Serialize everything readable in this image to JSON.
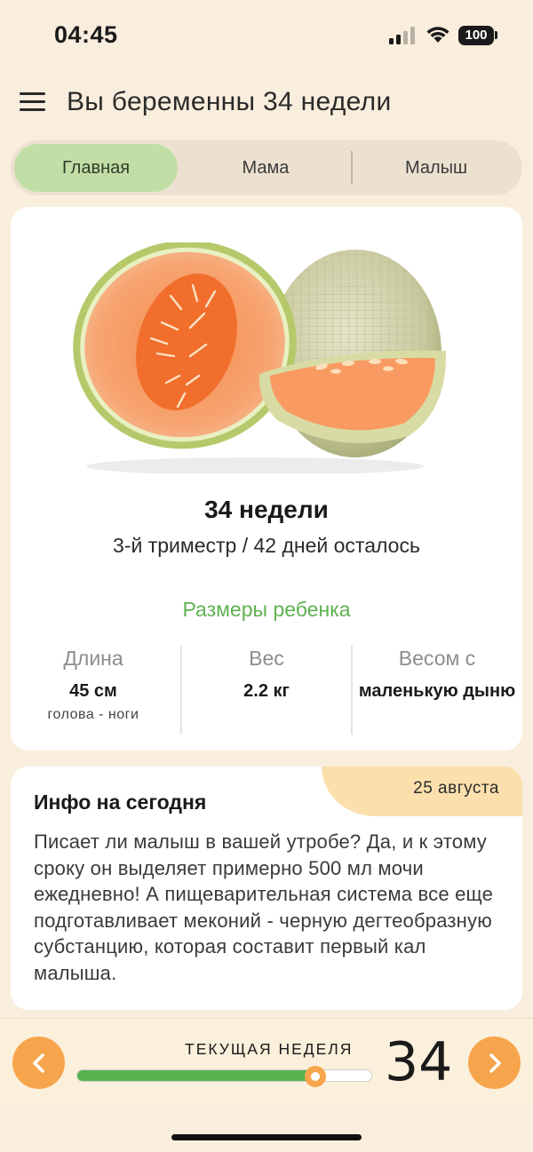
{
  "status_bar": {
    "time": "04:45",
    "battery": "100"
  },
  "header": {
    "title": "Вы беременны 34 недели",
    "menu_icon": "hamburger-menu-icon"
  },
  "tabs": [
    {
      "label": "Главная",
      "active": true
    },
    {
      "label": "Мама",
      "active": false
    },
    {
      "label": "Малыш",
      "active": false
    }
  ],
  "week_card": {
    "image": "cantaloupe-melon-illustration",
    "title": "34 недели",
    "subtitle": "3-й триместр / 42 дней осталось",
    "sizes_title": "Размеры ребенка",
    "metrics": [
      {
        "label": "Длина",
        "value": "45 см",
        "note": "голова - ноги"
      },
      {
        "label": "Вес",
        "value": "2.2 кг",
        "note": ""
      },
      {
        "label": "Весом с",
        "value": "маленькую дыню",
        "note": ""
      }
    ],
    "colors": {
      "accent_green": "#5fb150"
    }
  },
  "info_card": {
    "title": "Инфо на сегодня",
    "date": "25 августа",
    "body": "Писает ли малыш в вашей утробе? Да, и к этому сроку он выделяет примерно 500 мл мочи ежедневно! А пищеварительная система все еще подготавливает меконий - черную дегтеобразную субстанцию, которая составит первый кал малыша."
  },
  "week_nav": {
    "label": "ТЕКУЩАЯ НЕДЕЛЯ",
    "current_week": "34",
    "progress_fraction": 0.81,
    "prev_icon": "chevron-left-icon",
    "next_icon": "chevron-right-icon",
    "colors": {
      "button": "#f7a54c",
      "fill": "#58b34f"
    }
  }
}
